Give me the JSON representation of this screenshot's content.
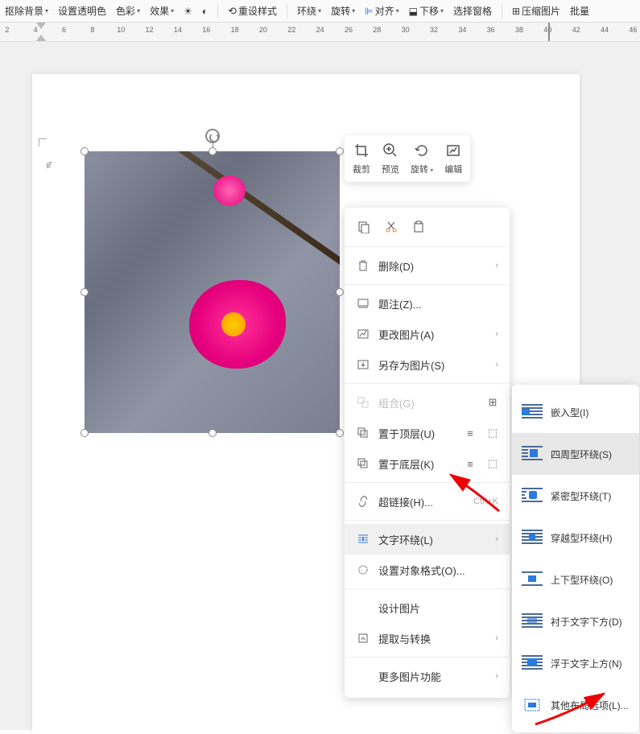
{
  "toolbar": {
    "remove_bg": "抠除背景",
    "set_trans": "设置透明色",
    "color": "色彩",
    "effect": "效果",
    "reset_style": "重设样式",
    "wrap": "环绕",
    "rotate": "旋转",
    "align": "对齐",
    "move_down": "下移",
    "select_pane": "选择窗格",
    "compress": "压缩图片",
    "batch": "批量"
  },
  "ruler_marks": [
    "2",
    "",
    "4",
    "",
    "6",
    "",
    "8",
    "",
    "10",
    "",
    "12",
    "",
    "14",
    "",
    "16",
    "",
    "18",
    "",
    "20",
    "",
    "22",
    "",
    "24",
    "",
    "26",
    "",
    "28",
    "",
    "30",
    "",
    "32",
    "",
    "34",
    "",
    "36",
    "",
    "38",
    "",
    "40",
    "",
    "42",
    "",
    "44",
    "",
    "46"
  ],
  "page_margin_symbol": "∉",
  "float_toolbar": {
    "crop": "裁剪",
    "preview": "预览",
    "rotate": "旋转",
    "edit": "编辑"
  },
  "context_menu": {
    "delete": "删除(D)",
    "caption": "题注(Z)...",
    "change_pic": "更改图片(A)",
    "save_as_pic": "另存为图片(S)",
    "group": "组合(G)",
    "bring_front": "置于顶层(U)",
    "send_back": "置于底层(K)",
    "hyperlink": "超链接(H)...",
    "hyperlink_sc": "Ctrl+K",
    "text_wrap": "文字环绕(L)",
    "format_obj": "设置对象格式(O)...",
    "design_pic": "设计图片",
    "extract": "提取与转换",
    "more_pic": "更多图片功能"
  },
  "submenu": {
    "inline": "嵌入型(I)",
    "square": "四周型环绕(S)",
    "tight": "紧密型环绕(T)",
    "through": "穿越型环绕(H)",
    "top_bottom": "上下型环绕(O)",
    "behind": "衬于文字下方(D)",
    "front": "浮于文字上方(N)",
    "more_layout": "其他布局选项(L)..."
  }
}
